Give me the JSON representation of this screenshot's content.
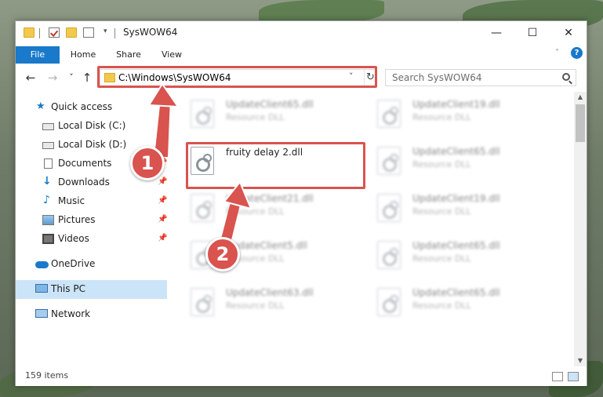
{
  "window": {
    "title": "SysWOW64",
    "minimize_glyph": "—",
    "maximize_glyph": "☐",
    "close_glyph": "✕"
  },
  "ribbon": {
    "tabs": [
      "File",
      "Home",
      "Share",
      "View"
    ],
    "help_glyph": "?"
  },
  "nav": {
    "back_glyph": "←",
    "forward_glyph": "→",
    "recent_glyph": "˅",
    "up_glyph": "↑"
  },
  "address": {
    "path": "C:\\Windows\\SysWOW64",
    "dropdown_glyph": "˅",
    "refresh_glyph": "↻"
  },
  "search": {
    "placeholder": "Search SysWOW64"
  },
  "sidebar": {
    "items": [
      {
        "label": "Quick access",
        "icon": "star-icon",
        "pinned": false
      },
      {
        "label": "Local Disk (C:)",
        "icon": "drive-icon",
        "pinned": true
      },
      {
        "label": "Local Disk (D:)",
        "icon": "drive-icon",
        "pinned": true
      },
      {
        "label": "Documents",
        "icon": "documents-icon",
        "pinned": true
      },
      {
        "label": "Downloads",
        "icon": "download-icon",
        "pinned": true
      },
      {
        "label": "Music",
        "icon": "music-icon",
        "pinned": true
      },
      {
        "label": "Pictures",
        "icon": "pictures-icon",
        "pinned": true
      },
      {
        "label": "Videos",
        "icon": "videos-icon",
        "pinned": true
      },
      {
        "label": "OneDrive",
        "icon": "cloud-icon",
        "pinned": false
      },
      {
        "label": "This PC",
        "icon": "computer-icon",
        "pinned": false,
        "selected": true
      },
      {
        "label": "Network",
        "icon": "network-icon",
        "pinned": false
      }
    ],
    "pin_glyph": "📌"
  },
  "files": {
    "left_column": [
      {
        "name": "UpdateClient65.dll",
        "type": "Resource DLL"
      },
      {
        "name": "fruity delay 2.dll",
        "type": ""
      },
      {
        "name": "UpdateClient21.dll",
        "type": "Resource DLL"
      },
      {
        "name": "UpdateClient5.dll",
        "type": "Resource DLL"
      },
      {
        "name": "UpdateClient63.dll",
        "type": "Resource DLL"
      }
    ],
    "right_column": [
      {
        "name": "UpdateClient19.dll",
        "type": "Resource DLL"
      },
      {
        "name": "UpdateClient65.dll",
        "type": "Resource DLL"
      },
      {
        "name": "UpdateClient19.dll",
        "type": "Resource DLL"
      },
      {
        "name": "UpdateClient65.dll",
        "type": "Resource DLL"
      },
      {
        "name": "UpdateClient65.dll",
        "type": "Resource DLL"
      }
    ]
  },
  "status": {
    "item_count": "159 items"
  },
  "annotations": {
    "badge1": "1",
    "badge2": "2",
    "color": "#d9534f"
  }
}
